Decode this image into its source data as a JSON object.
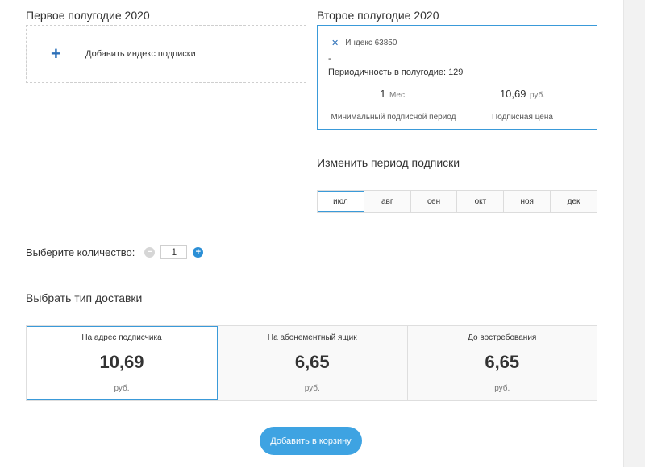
{
  "first_half": {
    "title": "Первое полугодие 2020",
    "add_label": "Добавить индекс подписки"
  },
  "second_half": {
    "title": "Второе полугодие 2020",
    "card": {
      "index_label": "Индекс 63850",
      "dash": "-",
      "periodicity": "Периодичность в полугодие: 129",
      "min_period_value": "1",
      "min_period_unit": "Мес.",
      "min_period_caption": "Минимальный подписной период",
      "price_value": "10,69",
      "price_unit": "руб.",
      "price_caption": "Подписная цена"
    }
  },
  "change_period": {
    "title": "Изменить период подписки",
    "months": [
      "июл",
      "авг",
      "сен",
      "окт",
      "ноя",
      "дек"
    ],
    "selected": "июл"
  },
  "quantity": {
    "label": "Выберите количество:",
    "value": "1"
  },
  "delivery": {
    "title": "Выбрать тип доставки",
    "options": [
      {
        "name": "На адрес подписчика",
        "price": "10,69",
        "currency": "руб."
      },
      {
        "name": "На абонементный ящик",
        "price": "6,65",
        "currency": "руб."
      },
      {
        "name": "До востребования",
        "price": "6,65",
        "currency": "руб."
      }
    ],
    "selected_index": 0
  },
  "cart_button": "Добавить в корзину",
  "colors": {
    "accent": "#3a9ad9",
    "button": "#3ea3e2",
    "icon_blue": "#2b6fb8"
  }
}
